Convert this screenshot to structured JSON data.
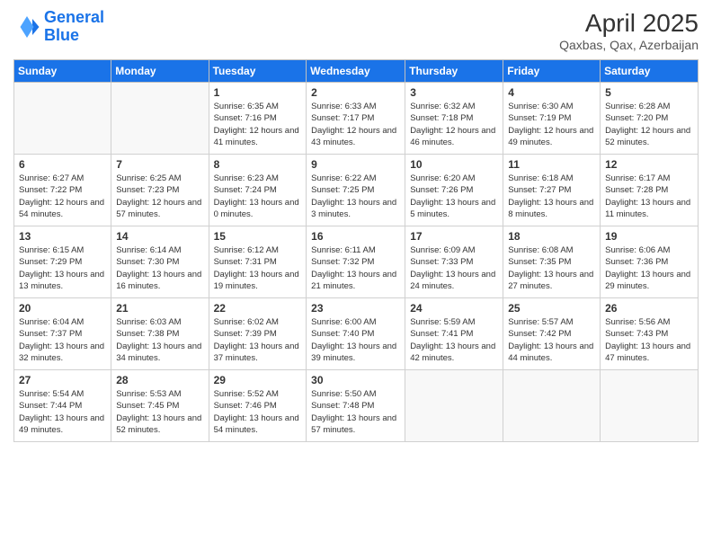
{
  "logo": {
    "line1": "General",
    "line2": "Blue"
  },
  "title": "April 2025",
  "subtitle": "Qaxbas, Qax, Azerbaijan",
  "days_of_week": [
    "Sunday",
    "Monday",
    "Tuesday",
    "Wednesday",
    "Thursday",
    "Friday",
    "Saturday"
  ],
  "weeks": [
    [
      {
        "day": "",
        "sunrise": "",
        "sunset": "",
        "daylight": ""
      },
      {
        "day": "",
        "sunrise": "",
        "sunset": "",
        "daylight": ""
      },
      {
        "day": "1",
        "sunrise": "Sunrise: 6:35 AM",
        "sunset": "Sunset: 7:16 PM",
        "daylight": "Daylight: 12 hours and 41 minutes."
      },
      {
        "day": "2",
        "sunrise": "Sunrise: 6:33 AM",
        "sunset": "Sunset: 7:17 PM",
        "daylight": "Daylight: 12 hours and 43 minutes."
      },
      {
        "day": "3",
        "sunrise": "Sunrise: 6:32 AM",
        "sunset": "Sunset: 7:18 PM",
        "daylight": "Daylight: 12 hours and 46 minutes."
      },
      {
        "day": "4",
        "sunrise": "Sunrise: 6:30 AM",
        "sunset": "Sunset: 7:19 PM",
        "daylight": "Daylight: 12 hours and 49 minutes."
      },
      {
        "day": "5",
        "sunrise": "Sunrise: 6:28 AM",
        "sunset": "Sunset: 7:20 PM",
        "daylight": "Daylight: 12 hours and 52 minutes."
      }
    ],
    [
      {
        "day": "6",
        "sunrise": "Sunrise: 6:27 AM",
        "sunset": "Sunset: 7:22 PM",
        "daylight": "Daylight: 12 hours and 54 minutes."
      },
      {
        "day": "7",
        "sunrise": "Sunrise: 6:25 AM",
        "sunset": "Sunset: 7:23 PM",
        "daylight": "Daylight: 12 hours and 57 minutes."
      },
      {
        "day": "8",
        "sunrise": "Sunrise: 6:23 AM",
        "sunset": "Sunset: 7:24 PM",
        "daylight": "Daylight: 13 hours and 0 minutes."
      },
      {
        "day": "9",
        "sunrise": "Sunrise: 6:22 AM",
        "sunset": "Sunset: 7:25 PM",
        "daylight": "Daylight: 13 hours and 3 minutes."
      },
      {
        "day": "10",
        "sunrise": "Sunrise: 6:20 AM",
        "sunset": "Sunset: 7:26 PM",
        "daylight": "Daylight: 13 hours and 5 minutes."
      },
      {
        "day": "11",
        "sunrise": "Sunrise: 6:18 AM",
        "sunset": "Sunset: 7:27 PM",
        "daylight": "Daylight: 13 hours and 8 minutes."
      },
      {
        "day": "12",
        "sunrise": "Sunrise: 6:17 AM",
        "sunset": "Sunset: 7:28 PM",
        "daylight": "Daylight: 13 hours and 11 minutes."
      }
    ],
    [
      {
        "day": "13",
        "sunrise": "Sunrise: 6:15 AM",
        "sunset": "Sunset: 7:29 PM",
        "daylight": "Daylight: 13 hours and 13 minutes."
      },
      {
        "day": "14",
        "sunrise": "Sunrise: 6:14 AM",
        "sunset": "Sunset: 7:30 PM",
        "daylight": "Daylight: 13 hours and 16 minutes."
      },
      {
        "day": "15",
        "sunrise": "Sunrise: 6:12 AM",
        "sunset": "Sunset: 7:31 PM",
        "daylight": "Daylight: 13 hours and 19 minutes."
      },
      {
        "day": "16",
        "sunrise": "Sunrise: 6:11 AM",
        "sunset": "Sunset: 7:32 PM",
        "daylight": "Daylight: 13 hours and 21 minutes."
      },
      {
        "day": "17",
        "sunrise": "Sunrise: 6:09 AM",
        "sunset": "Sunset: 7:33 PM",
        "daylight": "Daylight: 13 hours and 24 minutes."
      },
      {
        "day": "18",
        "sunrise": "Sunrise: 6:08 AM",
        "sunset": "Sunset: 7:35 PM",
        "daylight": "Daylight: 13 hours and 27 minutes."
      },
      {
        "day": "19",
        "sunrise": "Sunrise: 6:06 AM",
        "sunset": "Sunset: 7:36 PM",
        "daylight": "Daylight: 13 hours and 29 minutes."
      }
    ],
    [
      {
        "day": "20",
        "sunrise": "Sunrise: 6:04 AM",
        "sunset": "Sunset: 7:37 PM",
        "daylight": "Daylight: 13 hours and 32 minutes."
      },
      {
        "day": "21",
        "sunrise": "Sunrise: 6:03 AM",
        "sunset": "Sunset: 7:38 PM",
        "daylight": "Daylight: 13 hours and 34 minutes."
      },
      {
        "day": "22",
        "sunrise": "Sunrise: 6:02 AM",
        "sunset": "Sunset: 7:39 PM",
        "daylight": "Daylight: 13 hours and 37 minutes."
      },
      {
        "day": "23",
        "sunrise": "Sunrise: 6:00 AM",
        "sunset": "Sunset: 7:40 PM",
        "daylight": "Daylight: 13 hours and 39 minutes."
      },
      {
        "day": "24",
        "sunrise": "Sunrise: 5:59 AM",
        "sunset": "Sunset: 7:41 PM",
        "daylight": "Daylight: 13 hours and 42 minutes."
      },
      {
        "day": "25",
        "sunrise": "Sunrise: 5:57 AM",
        "sunset": "Sunset: 7:42 PM",
        "daylight": "Daylight: 13 hours and 44 minutes."
      },
      {
        "day": "26",
        "sunrise": "Sunrise: 5:56 AM",
        "sunset": "Sunset: 7:43 PM",
        "daylight": "Daylight: 13 hours and 47 minutes."
      }
    ],
    [
      {
        "day": "27",
        "sunrise": "Sunrise: 5:54 AM",
        "sunset": "Sunset: 7:44 PM",
        "daylight": "Daylight: 13 hours and 49 minutes."
      },
      {
        "day": "28",
        "sunrise": "Sunrise: 5:53 AM",
        "sunset": "Sunset: 7:45 PM",
        "daylight": "Daylight: 13 hours and 52 minutes."
      },
      {
        "day": "29",
        "sunrise": "Sunrise: 5:52 AM",
        "sunset": "Sunset: 7:46 PM",
        "daylight": "Daylight: 13 hours and 54 minutes."
      },
      {
        "day": "30",
        "sunrise": "Sunrise: 5:50 AM",
        "sunset": "Sunset: 7:48 PM",
        "daylight": "Daylight: 13 hours and 57 minutes."
      },
      {
        "day": "",
        "sunrise": "",
        "sunset": "",
        "daylight": ""
      },
      {
        "day": "",
        "sunrise": "",
        "sunset": "",
        "daylight": ""
      },
      {
        "day": "",
        "sunrise": "",
        "sunset": "",
        "daylight": ""
      }
    ]
  ]
}
